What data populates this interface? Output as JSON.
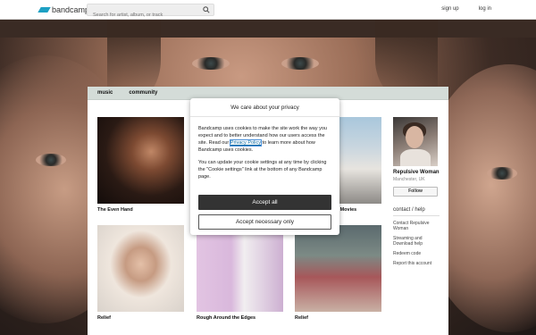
{
  "topbar": {
    "logo_text": "bandcamp",
    "search_placeholder": "Search for artist, album, or track",
    "signup": "sign up",
    "login": "log in"
  },
  "tabs": [
    "music",
    "community"
  ],
  "albums": [
    {
      "title": "The Even Hand"
    },
    {
      "title": ""
    },
    {
      "title": "e Movies"
    },
    {
      "title": "Relief"
    },
    {
      "title": "Rough Around the Edges"
    },
    {
      "title": "Relief"
    }
  ],
  "artist": {
    "name": "Repulsive Woman",
    "location": "Manchester, UK",
    "follow": "Follow",
    "contact_help": "contact / help",
    "links": [
      "Contact Repulsive Woman",
      "Streaming and Download help",
      "Redeem code",
      "Report this account"
    ]
  },
  "modal": {
    "title": "We care about your privacy",
    "p1_before": "Bandcamp uses cookies to make the site work the way you expect and to better understand how our users access the site. Read our ",
    "privacy_link": "Privacy Policy",
    "p1_after": " to learn more about how Bandcamp uses cookies.",
    "p2": "You can update your cookie settings at any time by clicking the \"Cookie settings\" link at the bottom of any Bandcamp page.",
    "accept_all": "Accept all",
    "accept_necessary": "Accept necessary only"
  },
  "colors": {
    "brand": "#1da0c3",
    "accept_button": "#333333"
  }
}
